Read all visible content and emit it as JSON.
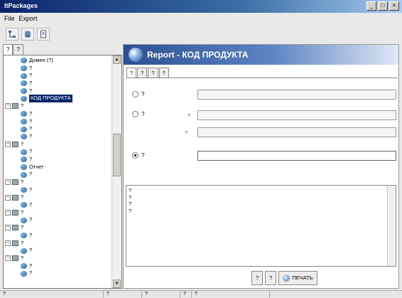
{
  "window": {
    "title": "ItPackages"
  },
  "menu": [
    "File",
    "Export"
  ],
  "toolbar": {
    "icons": [
      "tree-structure-icon",
      "database-icon",
      "document-icon"
    ]
  },
  "left_tabs": [
    "?",
    "?"
  ],
  "tree": [
    {
      "kind": "leaf",
      "label": "Домен (?)"
    },
    {
      "kind": "leaf",
      "label": "?"
    },
    {
      "kind": "leaf",
      "label": "?"
    },
    {
      "kind": "leaf",
      "label": "?"
    },
    {
      "kind": "leaf",
      "label": "?"
    },
    {
      "kind": "leaf",
      "label": "КОД ПРОДУКТА",
      "selected": true
    },
    {
      "kind": "group",
      "label": "?"
    },
    {
      "kind": "leaf",
      "label": "?"
    },
    {
      "kind": "leaf",
      "label": "?"
    },
    {
      "kind": "leaf",
      "label": "?"
    },
    {
      "kind": "leaf",
      "label": "?"
    },
    {
      "kind": "group",
      "label": "?"
    },
    {
      "kind": "leaf",
      "label": "?"
    },
    {
      "kind": "leaf",
      "label": "?"
    },
    {
      "kind": "leaf",
      "label": "Отчет"
    },
    {
      "kind": "leaf",
      "label": "?"
    },
    {
      "kind": "group",
      "label": "?"
    },
    {
      "kind": "leaf",
      "label": "?"
    },
    {
      "kind": "group",
      "label": "?"
    },
    {
      "kind": "leaf",
      "label": "?"
    },
    {
      "kind": "group",
      "label": "?"
    },
    {
      "kind": "leaf",
      "label": "?"
    },
    {
      "kind": "group",
      "label": "?"
    },
    {
      "kind": "leaf",
      "label": "?"
    },
    {
      "kind": "group",
      "label": "?"
    },
    {
      "kind": "leaf",
      "label": "?"
    },
    {
      "kind": "group",
      "label": "?"
    },
    {
      "kind": "leaf",
      "label": "?"
    },
    {
      "kind": "leaf",
      "label": "?"
    }
  ],
  "right": {
    "title": "Report - КОД ПРОДУКТА",
    "logo": "",
    "tabs": [
      "?",
      "?",
      "?",
      "?"
    ],
    "radio_1": "?",
    "radio_2": "?",
    "radio_3": "?",
    "from_label": "?",
    "to_label": "?",
    "output_lines": [
      "?",
      "?",
      "?",
      "?"
    ],
    "btn_1": "?",
    "btn_2": "?",
    "btn_print": "ПЕЧАТЬ"
  },
  "status": [
    "?",
    "?",
    "?",
    "?",
    "?"
  ]
}
